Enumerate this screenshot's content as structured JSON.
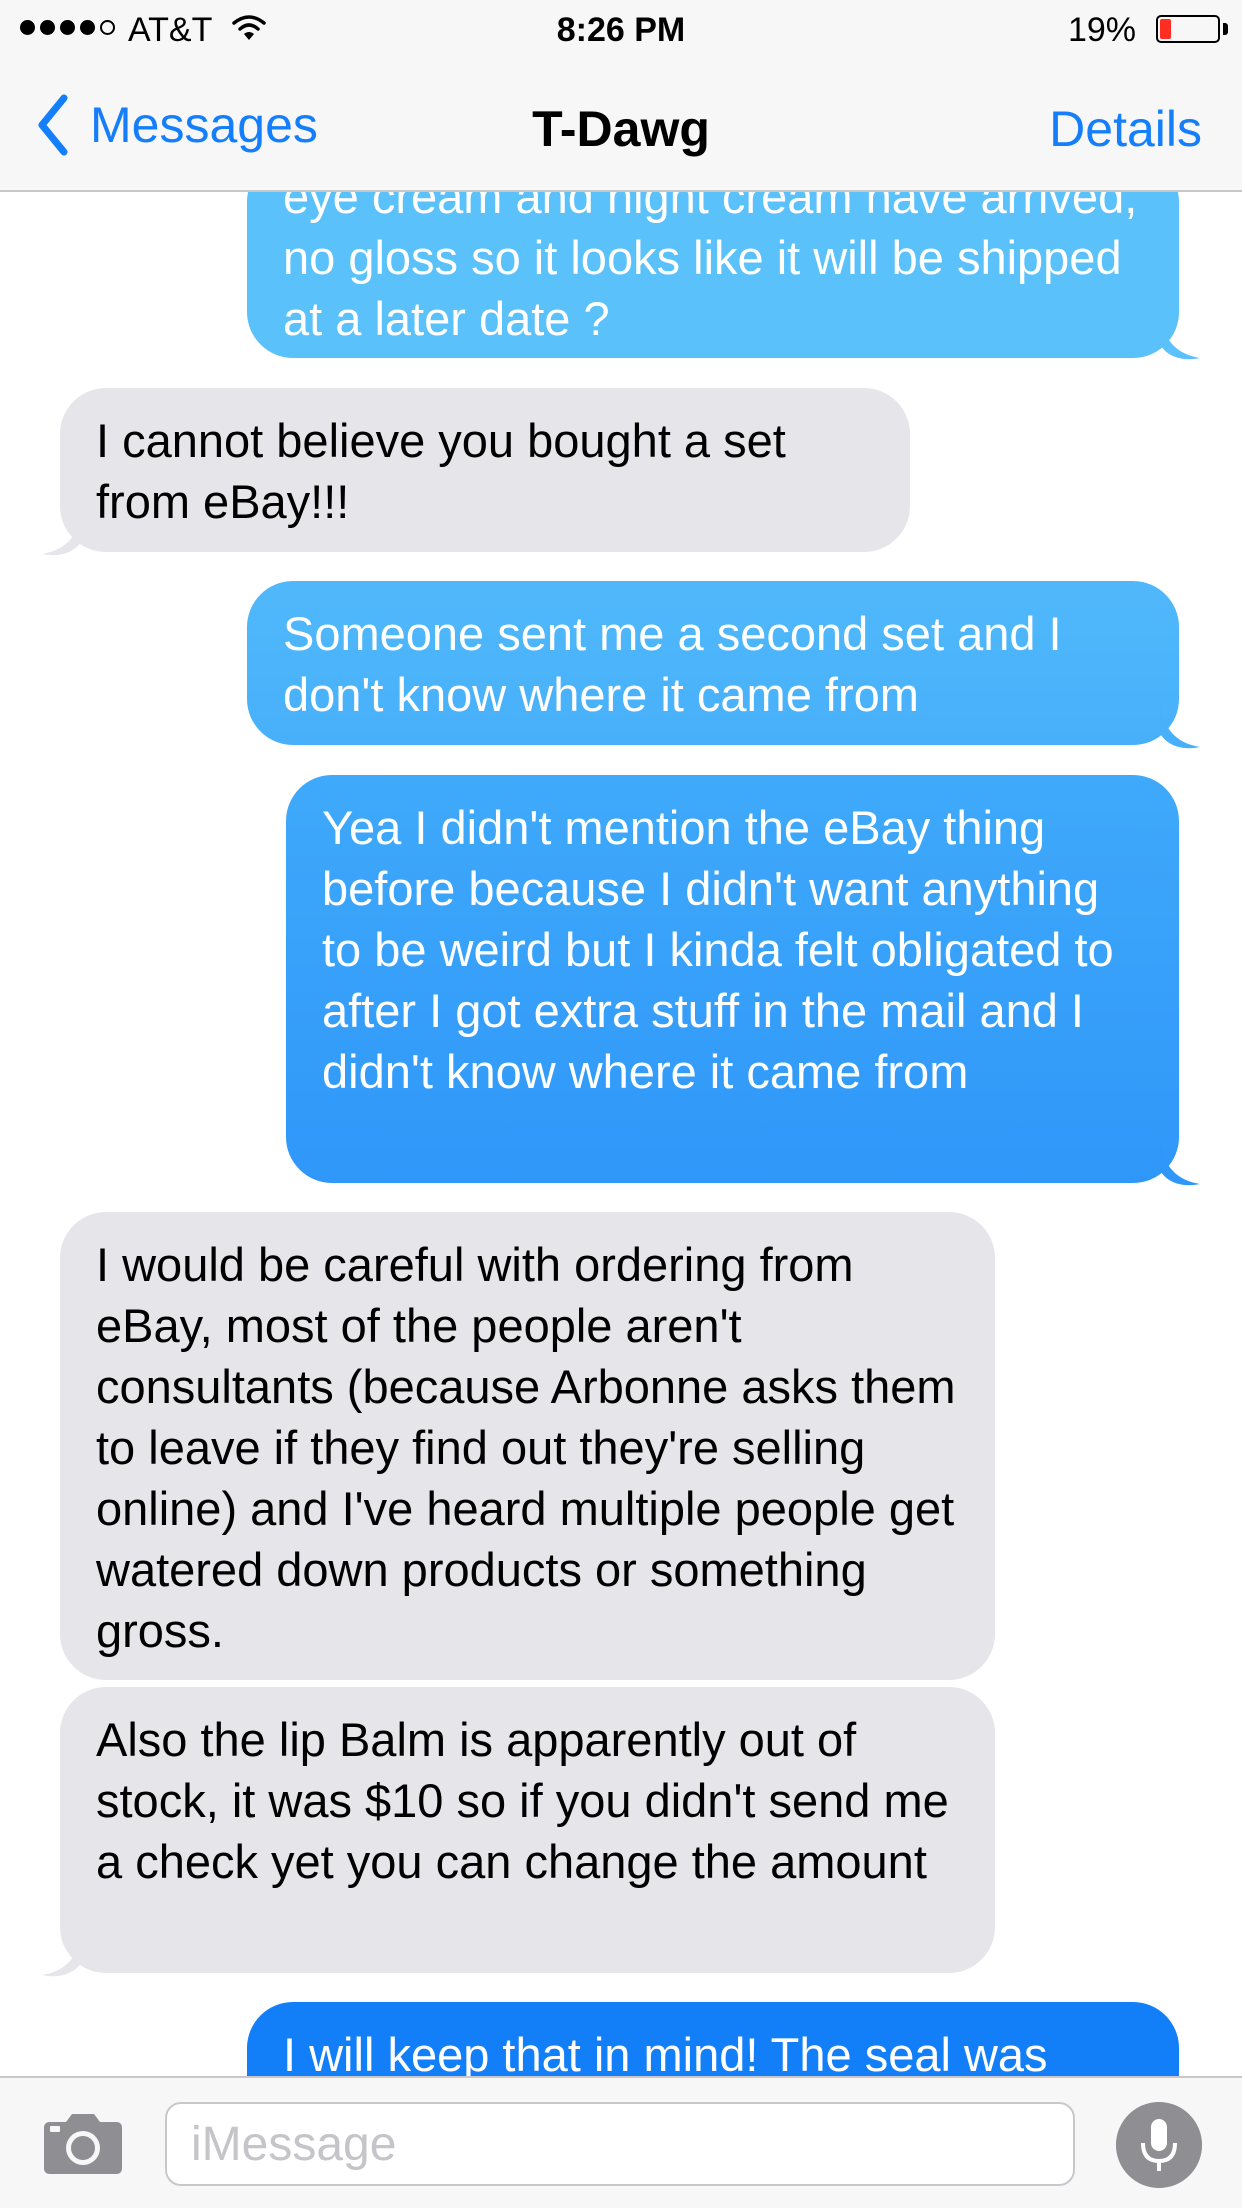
{
  "status_bar": {
    "carrier": "AT&T",
    "time": "8:26 PM",
    "battery_percent": "19%",
    "battery_level": 0.19,
    "battery_color": "#ff2d22",
    "signal_bars": 4,
    "signal_total": 5
  },
  "nav": {
    "back_label": "Messages",
    "title": "T-Dawg",
    "details_label": "Details",
    "accent_color": "#157efb"
  },
  "messages": [
    {
      "direction": "out",
      "text": "eye cream and night cream have arrived, no gloss so it looks like it will be shipped at a later date ?"
    },
    {
      "direction": "in",
      "text": "I cannot believe you bought a set from eBay!!!"
    },
    {
      "direction": "out",
      "text": "Someone sent me a second set and I don't know where it came from"
    },
    {
      "direction": "out",
      "text": "Yea I didn't mention the eBay thing before because I didn't want anything to be weird but I kinda felt obligated to after I got extra stuff in the mail and I didn't know where it came from"
    },
    {
      "direction": "in",
      "text": "I would be careful with ordering from eBay, most of the people aren't consultants (because Arbonne asks them to leave if they find out they're selling online) and I've heard multiple people get watered down products or something gross."
    },
    {
      "direction": "in",
      "text": "Also the lip Balm is apparently out of stock, it was $10 so if you didn't send me a check yet you can change the amount"
    },
    {
      "direction": "out",
      "text": "I will keep that in mind! The seal was"
    }
  ],
  "input": {
    "placeholder": "iMessage",
    "value": ""
  },
  "icons": {
    "camera": "camera-icon",
    "mic": "microphone-icon",
    "back": "chevron-left-icon",
    "wifi": "wifi-icon"
  },
  "colors": {
    "incoming_bubble": "#e5e5ea",
    "outgoing_gradient_light": "#5ac1fb",
    "outgoing_gradient_dark": "#127ff8"
  }
}
